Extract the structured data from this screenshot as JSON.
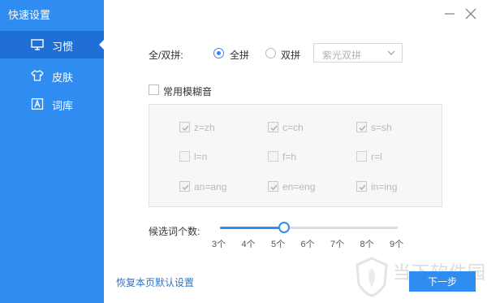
{
  "app_title": "快速设置",
  "sidebar": {
    "items": [
      {
        "label": "习惯",
        "icon": "monitor-icon",
        "active": true
      },
      {
        "label": "皮肤",
        "icon": "tshirt-icon",
        "active": false
      },
      {
        "label": "词库",
        "icon": "font-a-icon",
        "active": false
      }
    ]
  },
  "pinyin": {
    "label": "全/双拼:",
    "options": [
      "全拼",
      "双拼"
    ],
    "selected": "全拼",
    "scheme_value": "紫光双拼"
  },
  "fuzzy": {
    "label": "常用模糊音",
    "enabled": false,
    "items": [
      {
        "label": "z=zh",
        "checked": true
      },
      {
        "label": "c=ch",
        "checked": true
      },
      {
        "label": "s=sh",
        "checked": true
      },
      {
        "label": "l=n",
        "checked": false
      },
      {
        "label": "f=h",
        "checked": false
      },
      {
        "label": "r=l",
        "checked": false
      },
      {
        "label": "an=ang",
        "checked": true
      },
      {
        "label": "en=eng",
        "checked": true
      },
      {
        "label": "in=ing",
        "checked": true
      }
    ]
  },
  "candidates": {
    "label": "候选词个数:",
    "ticks": [
      "3个",
      "4个",
      "5个",
      "6个",
      "7个",
      "8个",
      "9个"
    ],
    "value": 5,
    "min": 3,
    "max": 9
  },
  "footer": {
    "restore_label": "恢复本页默认设置",
    "next_label": "下一步"
  },
  "watermark": {
    "text": "当下软件园"
  },
  "colors": {
    "accent": "#2f8cf0",
    "sidebar_active": "#1f6fd6",
    "link": "#2f72c8"
  }
}
